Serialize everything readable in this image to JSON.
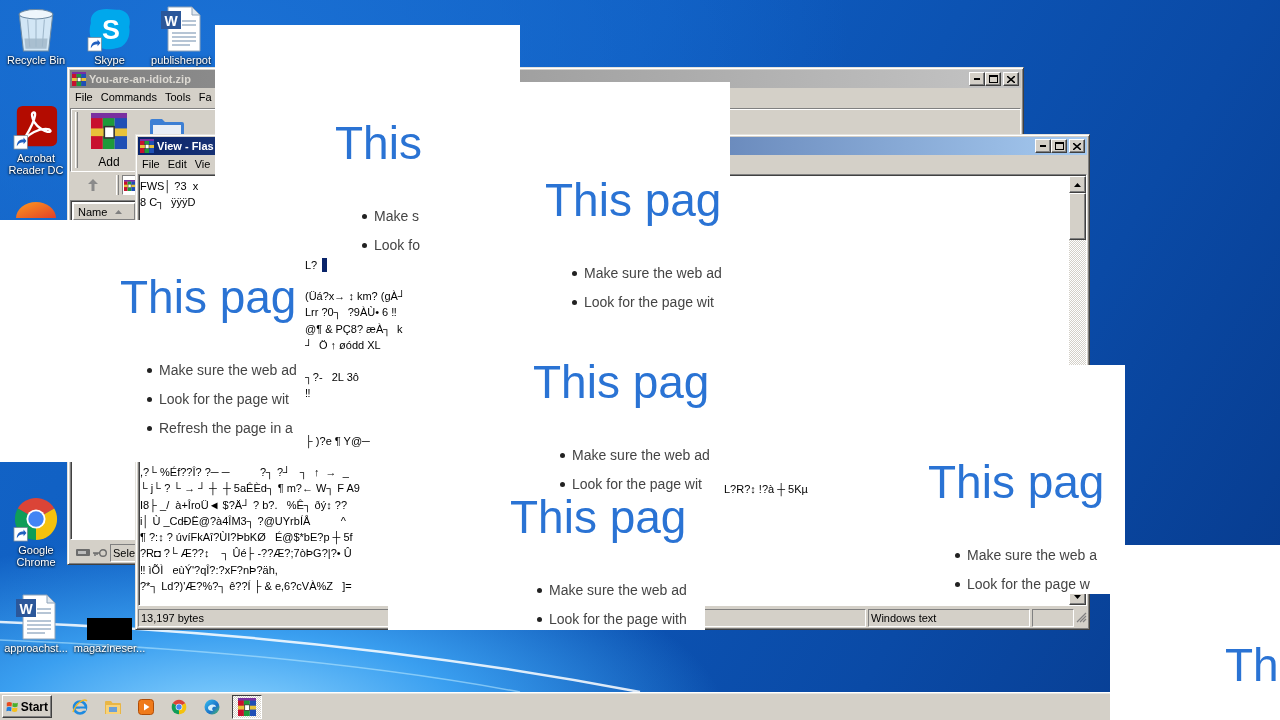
{
  "desktop_icons": [
    {
      "label": "Recycle Bin",
      "kind": "bin"
    },
    {
      "label": "Skype",
      "kind": "chat",
      "glyph": "S"
    },
    {
      "label": "publisherpot",
      "kind": "document",
      "glyph": "W"
    },
    {
      "label": "Acrobat Reader DC",
      "kind": "pdf"
    },
    {
      "kind": "partial"
    },
    {
      "label": "Google Chrome",
      "kind": "browser"
    },
    {
      "label": "approachst...",
      "kind": "document",
      "glyph": "W"
    },
    {
      "label": "magazineser...",
      "kind": "blank"
    }
  ],
  "archive_window": {
    "title": "You-are-an-idiot.zip",
    "active": false,
    "menu": [
      "File",
      "Commands",
      "Tools",
      "Fa"
    ],
    "toolbar": [
      {
        "label": "Add"
      }
    ],
    "column": {
      "label": "Name",
      "ascending": true
    },
    "status": "Sele"
  },
  "viewer_window": {
    "title": "View - Flas",
    "active": true,
    "menu": [
      "File",
      "Edit",
      "Vie"
    ],
    "text_blocks": [
      {
        "lines": [
          "FWS│ ?3  x",
          "8 C┐  ÿÿÿD"
        ]
      },
      {
        "lines": [
          "L?"
        ],
        "cursor": true
      },
      {
        "lines": [
          "(Üá?x→ ↕ km? (gÀ┘",
          "Lrr ?0┐  ?9ÀÙ• 6 ‼",
          "@¶ & PÇ8? æÀ┐  k",
          "┘  Ö ↑ øódd XL"
        ]
      },
      {
        "lines": [
          "┐?-   2L 3ô",
          "‼"
        ]
      },
      {
        "lines": [
          "├ )?e ¶ Y@─"
        ]
      },
      {
        "lines": [
          ",?└ %Éf??Î? ?─ ─          ?┐ ?┘   ┐  ↑  →  _",
          "└ j└ ? └ → ┘ ┼  ┼ 5aÊÈd┐ ¶ m?← W┐ F A9",
          "I8├ _/  à+ÎroÜ◄ $?Ä┘ ? b?.   %Ê┐ ðý↕ ??",
          "i│ Ù _CdÐË@?à4ÎM3┐ ?@UYrbÍÅ          ^",
          "¶ ?:↕ ? úvíFkAî?ÙI?ÞbKØ   É@$*bE?p ┼ 5f",
          "?R◘ ?└ Æ??↕    ┐ Ûé├ -??Æ?;7òÞG?|?• Û",
          "‼ ìÕÌ   eùÝ'?qÎ?:?xF?nÞ?äh,",
          "?*┐ Ld?)'Æ?%?┐ ê??Í ├ & e,6?cVÀ%Z   ]="
        ]
      },
      {
        "lines": [
          "L?R?↕ !?à ┼ 5Kµ"
        ]
      }
    ],
    "status_bar": [
      "13,197 bytes",
      "Windows text"
    ]
  },
  "error_pages": [
    {
      "heading": "This",
      "bullets": [
        "Make s",
        "Look fo"
      ]
    },
    {
      "heading": "This pag",
      "bullets": [
        "Make sure the web ad",
        "Look for the page wit"
      ]
    },
    {
      "heading": "This pag",
      "bullets": [
        "Make sure the web ad",
        "Look for the page wit",
        "Refresh the page in a"
      ]
    },
    {
      "heading": "This pag",
      "bullets": [
        "Make sure the web ad",
        "Look for the page wit"
      ]
    },
    {
      "heading": "This pag",
      "bullets": [
        "Make sure the web ad",
        "Look for the page with"
      ]
    },
    {
      "heading": "This pag",
      "bullets": [
        "Make sure the web a",
        "Look for the page w"
      ]
    },
    {
      "heading": "Th"
    }
  ],
  "taskbar": {
    "start": "Start",
    "tasks": [
      {
        "selected": true
      }
    ]
  }
}
